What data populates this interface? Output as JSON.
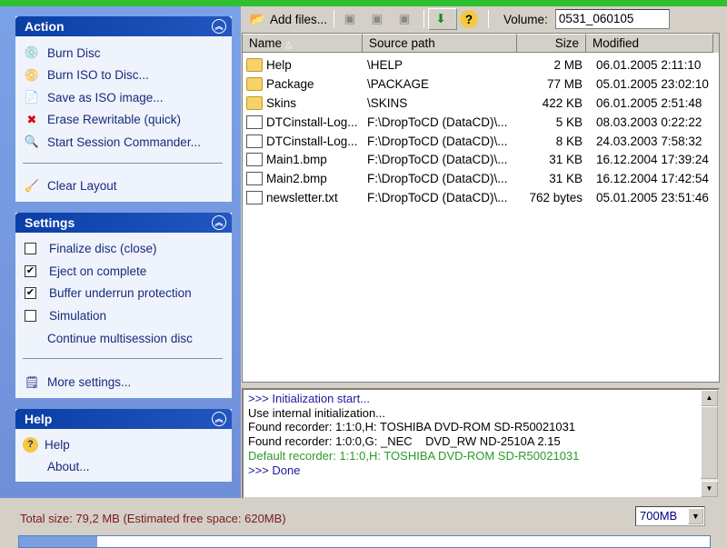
{
  "action": {
    "title": "Action",
    "items": [
      {
        "label": "Burn Disc",
        "icon": "burn-disc-icon"
      },
      {
        "label": "Burn ISO to Disc...",
        "icon": "burn-iso-icon"
      },
      {
        "label": "Save as ISO image...",
        "icon": "save-iso-icon"
      },
      {
        "label": "Erase Rewritable (quick)",
        "icon": "erase-icon"
      },
      {
        "label": "Start Session Commander...",
        "icon": "magnifier-icon"
      }
    ],
    "clear_layout": "Clear Layout"
  },
  "settings": {
    "title": "Settings",
    "options": [
      {
        "label": "Finalize disc (close)",
        "checked": false
      },
      {
        "label": "Eject on complete",
        "checked": true
      },
      {
        "label": "Buffer underrun protection",
        "checked": true
      },
      {
        "label": "Simulation",
        "checked": false
      }
    ],
    "continue_multisession": "Continue multisession disc",
    "more_settings": "More settings..."
  },
  "help": {
    "title": "Help",
    "help": "Help",
    "about": "About..."
  },
  "toolbar": {
    "add_files": "Add files...",
    "volume_label": "Volume:",
    "volume_value": "0531_060105"
  },
  "columns": [
    "Name",
    "Source path",
    "Size",
    "Modified"
  ],
  "files": [
    {
      "name": "Help",
      "path": "\\HELP",
      "size": "2 MB",
      "modified": "06.01.2005 2:11:10",
      "type": "folder"
    },
    {
      "name": "Package",
      "path": "\\PACKAGE",
      "size": "77 MB",
      "modified": "05.01.2005 23:02:10",
      "type": "folder"
    },
    {
      "name": "Skins",
      "path": "\\SKINS",
      "size": "422 KB",
      "modified": "06.01.2005 2:51:48",
      "type": "folder"
    },
    {
      "name": "DTCinstall-Log...",
      "path": "F:\\DropToCD (DataCD)\\...",
      "size": "5 KB",
      "modified": "08.03.2003 0:22:22",
      "type": "file"
    },
    {
      "name": "DTCinstall-Log...",
      "path": "F:\\DropToCD (DataCD)\\...",
      "size": "8 KB",
      "modified": "24.03.2003 7:58:32",
      "type": "file"
    },
    {
      "name": "Main1.bmp",
      "path": "F:\\DropToCD (DataCD)\\...",
      "size": "31 KB",
      "modified": "16.12.2004 17:39:24",
      "type": "file"
    },
    {
      "name": "Main2.bmp",
      "path": "F:\\DropToCD (DataCD)\\...",
      "size": "31 KB",
      "modified": "16.12.2004 17:42:54",
      "type": "file"
    },
    {
      "name": "newsletter.txt",
      "path": "F:\\DropToCD (DataCD)\\...",
      "size": "762 bytes",
      "modified": "05.01.2005 23:51:46",
      "type": "file"
    }
  ],
  "log": [
    {
      "text": ">>> Initialization start...",
      "color": "#1a1a9a"
    },
    {
      "text": "Use internal initialization...",
      "color": "#000000"
    },
    {
      "text": "Found recorder: 1:1:0,H: TOSHIBA DVD-ROM SD-R50021031",
      "color": "#000000"
    },
    {
      "text": "Found recorder: 1:0:0,G: _NEC    DVD_RW ND-2510A 2.15",
      "color": "#000000"
    },
    {
      "text": "Default recorder: 1:1:0,H: TOSHIBA DVD-ROM SD-R50021031",
      "color": "#2a9a2a"
    },
    {
      "text": ">>> Done",
      "color": "#1a1a9a"
    }
  ],
  "status": {
    "total": "Total size: 79,2 MB (Estimated free space: 620MB)",
    "disc_size": "700MB",
    "usage_percent": 11.3
  }
}
